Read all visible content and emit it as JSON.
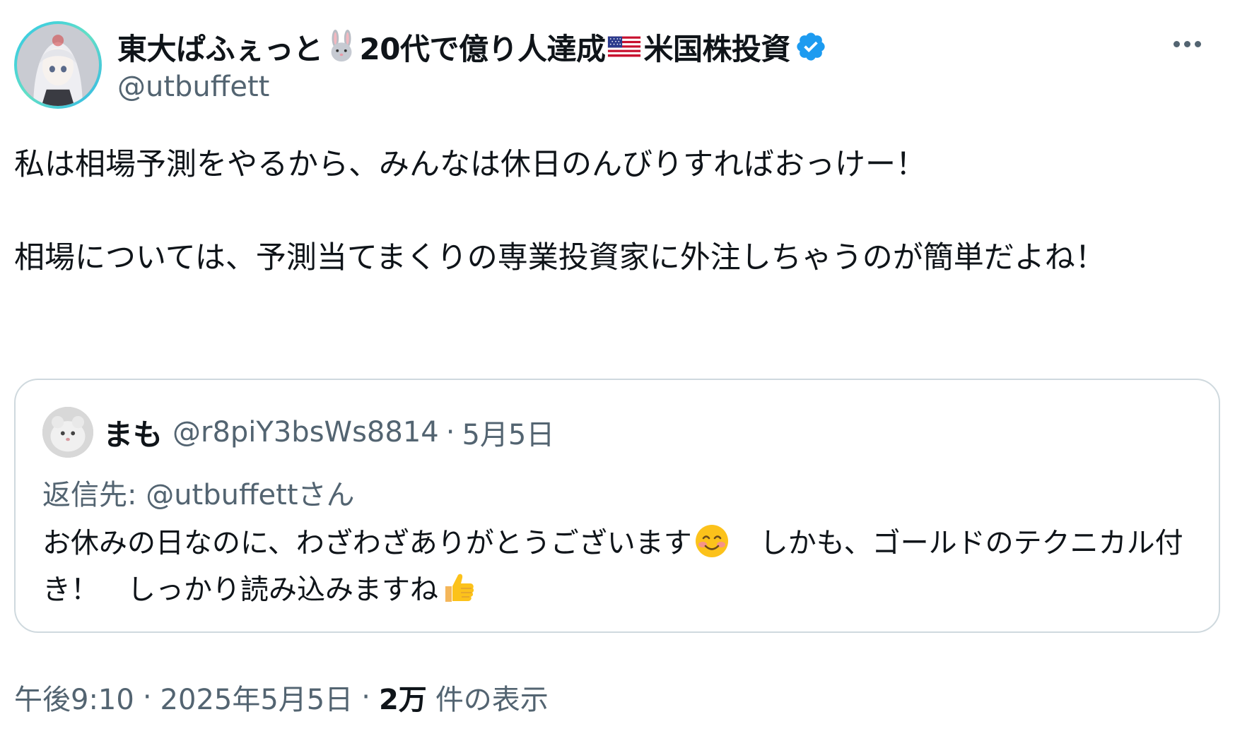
{
  "tweet": {
    "author": {
      "display_name_part1": "東大ぱふぇっと",
      "display_name_part2": "20代で億り人達成",
      "display_name_part3": "米国株投資",
      "handle": "@utbuffett",
      "verified": true
    },
    "body": {
      "paragraph1": "私は相場予測をやるから、みんなは休日のんびりすればおっけー！",
      "paragraph2": "相場については、予測当てまくりの専業投資家に外注しちゃうのが簡単だよね！"
    },
    "quote": {
      "display_name": "まも",
      "handle": "@r8piY3bsWs8814",
      "separator": "·",
      "date": "5月5日",
      "reply_to": "返信先: @utbuffettさん",
      "text_part1": "お休みの日なのに、わざわざありがとうございます",
      "text_part2": "　しかも、ゴールドのテクニカル付き！　しっかり読み込みますね"
    },
    "meta": {
      "time": "午後9:10",
      "separator": "·",
      "date": "2025年5月5日",
      "views_count": "2万",
      "views_label": "件の表示"
    }
  },
  "icons": {
    "rabbit": "rabbit-emoji",
    "flag": "us-flag-emoji",
    "verified": "verified-badge-icon",
    "smile": "smiling-face-emoji",
    "thumbs": "thumbs-up-emoji",
    "more": "more-options-icon"
  },
  "colors": {
    "text_primary": "#0f1419",
    "text_secondary": "#536471",
    "verified_blue": "#1d9bf0",
    "border": "#cfd9de"
  }
}
